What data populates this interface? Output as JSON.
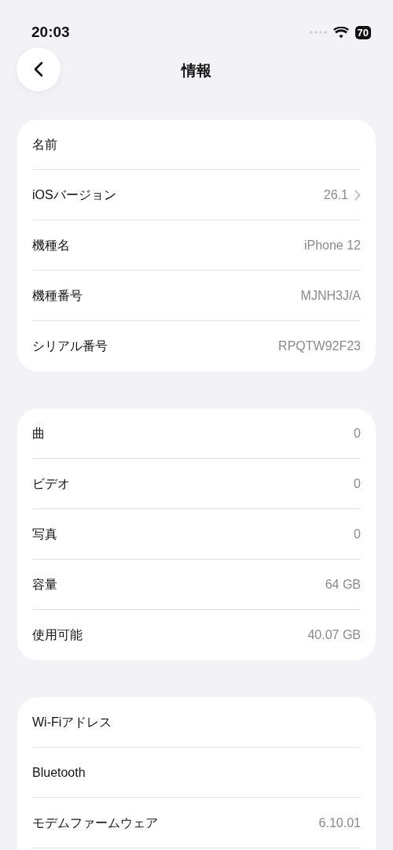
{
  "status_bar": {
    "time": "20:03",
    "battery": "70"
  },
  "nav": {
    "title": "情報"
  },
  "sections": [
    {
      "continues": false,
      "rows": [
        {
          "label": "名前",
          "disclosure": false
        },
        {
          "label": "iOSバージョン",
          "value": "26.1",
          "disclosure": true
        },
        {
          "label": "機種名",
          "value": "iPhone 12",
          "disclosure": false
        },
        {
          "label": "機種番号",
          "value": "MJNH3J/A",
          "disclosure": false
        },
        {
          "label": "シリアル番号",
          "value": "RPQTW92F23",
          "disclosure": false
        }
      ]
    },
    {
      "continues": false,
      "rows": [
        {
          "label": "曲",
          "value": "0",
          "disclosure": false
        },
        {
          "label": "ビデオ",
          "value": "0",
          "disclosure": false
        },
        {
          "label": "写真",
          "value": "0",
          "disclosure": false
        },
        {
          "label": "容量",
          "value": "64 GB",
          "disclosure": false
        },
        {
          "label": "使用可能",
          "value": "40.07 GB",
          "disclosure": false
        }
      ]
    },
    {
      "continues": true,
      "rows": [
        {
          "label": "Wi-Fiアドレス",
          "disclosure": false
        },
        {
          "label": "Bluetooth",
          "disclosure": false
        },
        {
          "label": "モデムファームウェア",
          "value": "6.10.01",
          "disclosure": false
        }
      ]
    }
  ]
}
